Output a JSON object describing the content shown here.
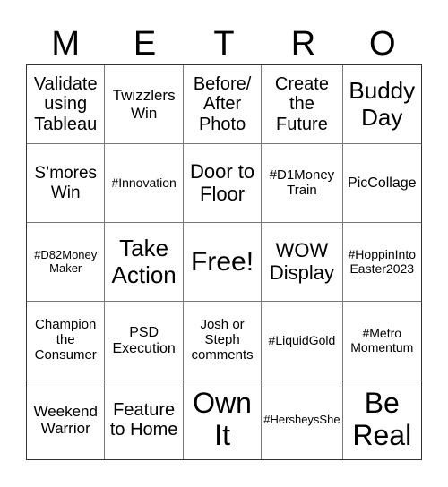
{
  "title_letters": [
    "M",
    "E",
    "T",
    "R",
    "O"
  ],
  "cells": [
    "Validate using Tableau",
    "Twizzlers Win",
    "Before/ After Photo",
    "Create the Future",
    "Buddy Day",
    "S’mores Win",
    "#Innovation",
    "Door to Floor",
    "#D1Money Train",
    "PicCollage",
    "#D82Money Maker",
    "Take Action",
    "Free!",
    "WOW Display",
    "#HoppinInto Easter2023",
    "Champion the Consumer",
    "PSD Execution",
    "Josh or Steph comments",
    "#LiquidGold",
    "#Metro Momentum",
    "Weekend Warrior",
    "Feature to Home",
    "Own It",
    "#HersheysShe",
    "Be Real"
  ]
}
